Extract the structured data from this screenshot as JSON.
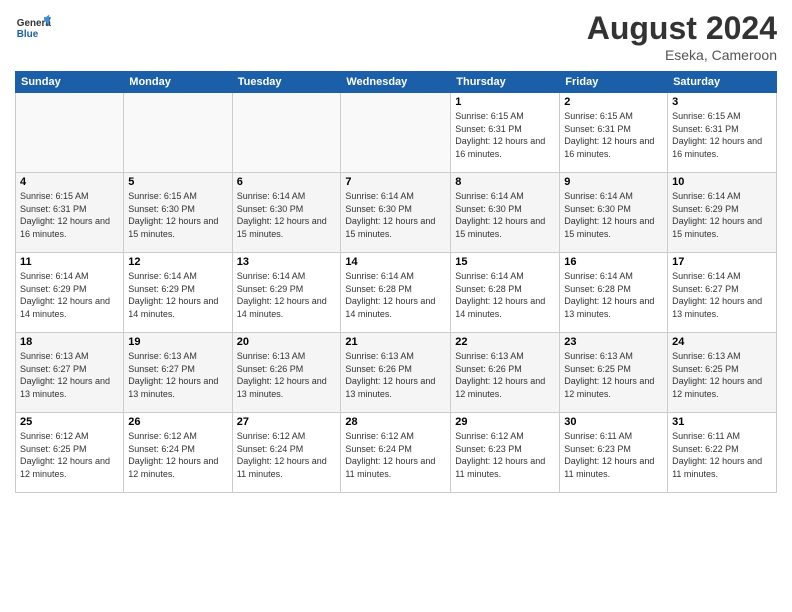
{
  "header": {
    "logo_general": "General",
    "logo_blue": "Blue",
    "month_title": "August 2024",
    "location": "Eseka, Cameroon"
  },
  "weekdays": [
    "Sunday",
    "Monday",
    "Tuesday",
    "Wednesday",
    "Thursday",
    "Friday",
    "Saturday"
  ],
  "weeks": [
    [
      {
        "day": "",
        "empty": true
      },
      {
        "day": "",
        "empty": true
      },
      {
        "day": "",
        "empty": true
      },
      {
        "day": "",
        "empty": true
      },
      {
        "day": "1",
        "sunrise": "6:15 AM",
        "sunset": "6:31 PM",
        "daylight": "12 hours and 16 minutes."
      },
      {
        "day": "2",
        "sunrise": "6:15 AM",
        "sunset": "6:31 PM",
        "daylight": "12 hours and 16 minutes."
      },
      {
        "day": "3",
        "sunrise": "6:15 AM",
        "sunset": "6:31 PM",
        "daylight": "12 hours and 16 minutes."
      }
    ],
    [
      {
        "day": "4",
        "sunrise": "6:15 AM",
        "sunset": "6:31 PM",
        "daylight": "12 hours and 16 minutes."
      },
      {
        "day": "5",
        "sunrise": "6:15 AM",
        "sunset": "6:30 PM",
        "daylight": "12 hours and 15 minutes."
      },
      {
        "day": "6",
        "sunrise": "6:14 AM",
        "sunset": "6:30 PM",
        "daylight": "12 hours and 15 minutes."
      },
      {
        "day": "7",
        "sunrise": "6:14 AM",
        "sunset": "6:30 PM",
        "daylight": "12 hours and 15 minutes."
      },
      {
        "day": "8",
        "sunrise": "6:14 AM",
        "sunset": "6:30 PM",
        "daylight": "12 hours and 15 minutes."
      },
      {
        "day": "9",
        "sunrise": "6:14 AM",
        "sunset": "6:30 PM",
        "daylight": "12 hours and 15 minutes."
      },
      {
        "day": "10",
        "sunrise": "6:14 AM",
        "sunset": "6:29 PM",
        "daylight": "12 hours and 15 minutes."
      }
    ],
    [
      {
        "day": "11",
        "sunrise": "6:14 AM",
        "sunset": "6:29 PM",
        "daylight": "12 hours and 14 minutes."
      },
      {
        "day": "12",
        "sunrise": "6:14 AM",
        "sunset": "6:29 PM",
        "daylight": "12 hours and 14 minutes."
      },
      {
        "day": "13",
        "sunrise": "6:14 AM",
        "sunset": "6:29 PM",
        "daylight": "12 hours and 14 minutes."
      },
      {
        "day": "14",
        "sunrise": "6:14 AM",
        "sunset": "6:28 PM",
        "daylight": "12 hours and 14 minutes."
      },
      {
        "day": "15",
        "sunrise": "6:14 AM",
        "sunset": "6:28 PM",
        "daylight": "12 hours and 14 minutes."
      },
      {
        "day": "16",
        "sunrise": "6:14 AM",
        "sunset": "6:28 PM",
        "daylight": "12 hours and 13 minutes."
      },
      {
        "day": "17",
        "sunrise": "6:14 AM",
        "sunset": "6:27 PM",
        "daylight": "12 hours and 13 minutes."
      }
    ],
    [
      {
        "day": "18",
        "sunrise": "6:13 AM",
        "sunset": "6:27 PM",
        "daylight": "12 hours and 13 minutes."
      },
      {
        "day": "19",
        "sunrise": "6:13 AM",
        "sunset": "6:27 PM",
        "daylight": "12 hours and 13 minutes."
      },
      {
        "day": "20",
        "sunrise": "6:13 AM",
        "sunset": "6:26 PM",
        "daylight": "12 hours and 13 minutes."
      },
      {
        "day": "21",
        "sunrise": "6:13 AM",
        "sunset": "6:26 PM",
        "daylight": "12 hours and 13 minutes."
      },
      {
        "day": "22",
        "sunrise": "6:13 AM",
        "sunset": "6:26 PM",
        "daylight": "12 hours and 12 minutes."
      },
      {
        "day": "23",
        "sunrise": "6:13 AM",
        "sunset": "6:25 PM",
        "daylight": "12 hours and 12 minutes."
      },
      {
        "day": "24",
        "sunrise": "6:13 AM",
        "sunset": "6:25 PM",
        "daylight": "12 hours and 12 minutes."
      }
    ],
    [
      {
        "day": "25",
        "sunrise": "6:12 AM",
        "sunset": "6:25 PM",
        "daylight": "12 hours and 12 minutes."
      },
      {
        "day": "26",
        "sunrise": "6:12 AM",
        "sunset": "6:24 PM",
        "daylight": "12 hours and 12 minutes."
      },
      {
        "day": "27",
        "sunrise": "6:12 AM",
        "sunset": "6:24 PM",
        "daylight": "12 hours and 11 minutes."
      },
      {
        "day": "28",
        "sunrise": "6:12 AM",
        "sunset": "6:24 PM",
        "daylight": "12 hours and 11 minutes."
      },
      {
        "day": "29",
        "sunrise": "6:12 AM",
        "sunset": "6:23 PM",
        "daylight": "12 hours and 11 minutes."
      },
      {
        "day": "30",
        "sunrise": "6:11 AM",
        "sunset": "6:23 PM",
        "daylight": "12 hours and 11 minutes."
      },
      {
        "day": "31",
        "sunrise": "6:11 AM",
        "sunset": "6:22 PM",
        "daylight": "12 hours and 11 minutes."
      }
    ]
  ]
}
